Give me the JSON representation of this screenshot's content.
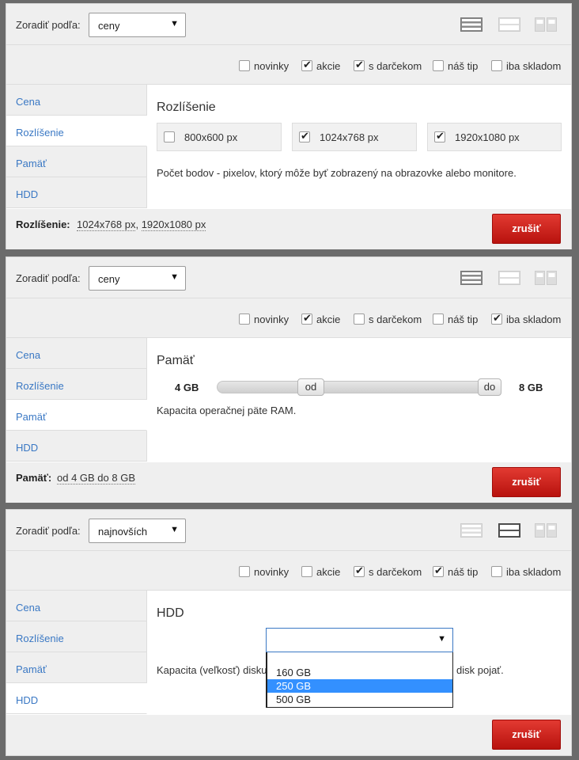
{
  "common": {
    "sort_label": "Zoradiť podľa:",
    "select_arrow": "▼",
    "tabs": [
      "Cena",
      "Rozlíšenie",
      "Pamäť",
      "HDD"
    ],
    "cancel_label": "zrušiť",
    "filters": [
      "novinky",
      "akcie",
      "s darčekom",
      "náš tip",
      "iba skladom"
    ],
    "colors": {
      "link": "#3a78c4",
      "cancel": "#d3221b",
      "highlight": "#3390ff"
    }
  },
  "panels": [
    {
      "sort_value": "ceny",
      "active_view": "list",
      "filters_checked": [
        false,
        true,
        true,
        false,
        false
      ],
      "active_tab": "Rozlíšenie",
      "content": {
        "title": "Rozlíšenie",
        "options": [
          {
            "label": "800x600 px",
            "checked": false
          },
          {
            "label": "1024x768 px",
            "checked": true
          },
          {
            "label": "1920x1080 px",
            "checked": true
          }
        ],
        "description": "Počet bodov - pixelov, ktorý môže byť zobrazený na obrazovke alebo monitore."
      },
      "footer": {
        "label": "Rozlíšenie:",
        "values": [
          "1024x768 px",
          "1920x1080 px"
        ]
      }
    },
    {
      "sort_value": "ceny",
      "active_view": "list",
      "filters_checked": [
        false,
        true,
        false,
        false,
        true
      ],
      "active_tab": "Pamäť",
      "content": {
        "title": "Pamäť",
        "slider": {
          "min_label": "4 GB",
          "max_label": "8 GB",
          "from_label": "od",
          "to_label": "do"
        },
        "description": "Kapacita operačnej päte RAM."
      },
      "footer": {
        "label": "Pamäť:",
        "values": [
          "od 4 GB do 8 GB"
        ]
      }
    },
    {
      "sort_value": "najnovších",
      "active_view": "compact",
      "filters_checked": [
        false,
        false,
        true,
        true,
        false
      ],
      "active_tab": "HDD",
      "content": {
        "title": "HDD",
        "select_value": "",
        "description_left": "Kapacita (veľkosť) disku",
        "description_right": "disk pojať.",
        "dropdown_options": [
          "160 GB",
          "250 GB",
          "500 GB"
        ],
        "dropdown_selected": "250 GB"
      },
      "footer": {
        "label": "",
        "values": []
      }
    }
  ]
}
